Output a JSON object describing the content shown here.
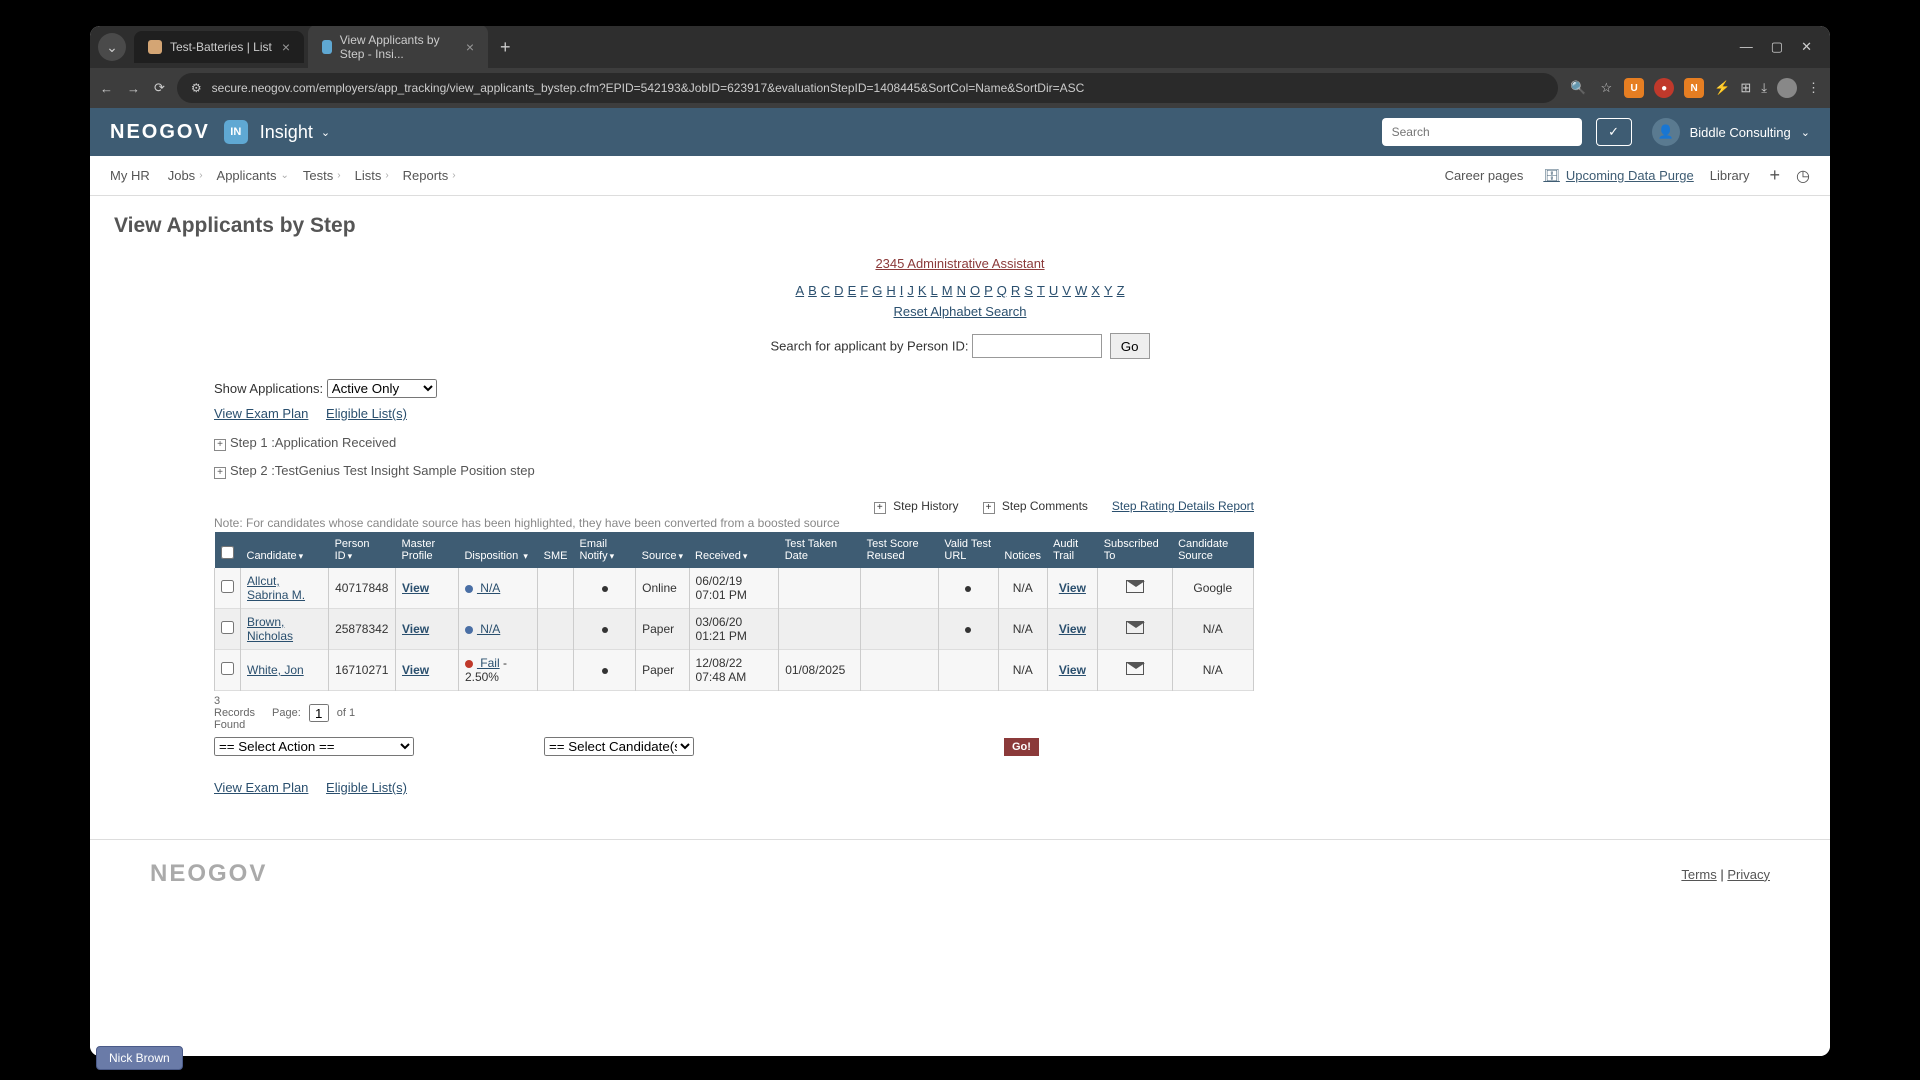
{
  "browser": {
    "tabs": [
      {
        "title": "Test-Batteries | List",
        "active": false,
        "favicon": "#d4a574"
      },
      {
        "title": "View Applicants by Step - Insi...",
        "active": true,
        "favicon": "#5fa8d3"
      }
    ],
    "url": "secure.neogov.com/employers/app_tracking/view_applicants_bystep.cfm?EPID=542193&JobID=623917&evaluationStepID=1408445&SortCol=Name&SortDir=ASC"
  },
  "header": {
    "logo": "NEOGOV",
    "badge": "IN",
    "product": "Insight",
    "search_placeholder": "Search",
    "user": "Biddle Consulting"
  },
  "nav": {
    "items": [
      "My HR",
      "Jobs",
      "Applicants",
      "Tests",
      "Lists",
      "Reports"
    ],
    "right": {
      "career": "Career pages",
      "purge": "Upcoming Data Purge",
      "library": "Library"
    }
  },
  "page": {
    "title": "View Applicants by Step",
    "job_link": "2345 Administrative Assistant",
    "alphabet": [
      "A",
      "B",
      "C",
      "D",
      "E",
      "F",
      "G",
      "H",
      "I",
      "J",
      "K",
      "L",
      "M",
      "N",
      "O",
      "P",
      "Q",
      "R",
      "S",
      "T",
      "U",
      "V",
      "W",
      "X",
      "Y",
      "Z"
    ],
    "reset_alpha": "Reset Alphabet Search",
    "search_label": "Search for applicant by Person ID:",
    "go_btn": "Go",
    "show_apps_label": "Show Applications:",
    "show_apps_value": "Active Only",
    "view_exam": "View Exam Plan",
    "eligible": "Eligible List(s)",
    "step1": "Step 1 :Application Received",
    "step2": "Step 2 :TestGenius Test Insight Sample Position step",
    "step_history": "Step History",
    "step_comments": "Step Comments",
    "step_rating": "Step Rating Details Report",
    "note": "Note: For candidates whose candidate source has been highlighted, they have been converted from a boosted source"
  },
  "table": {
    "headers": {
      "candidate": "Candidate",
      "person_id": "Person ID",
      "master": "Master Profile",
      "disposition": "Disposition",
      "sme": "SME",
      "email_notify": "Email Notify",
      "source": "Source",
      "received": "Received",
      "test_taken": "Test Taken Date",
      "test_score": "Test Score Reused",
      "valid_url": "Valid Test URL",
      "notices": "Notices",
      "audit": "Audit Trail",
      "subscribed": "Subscribed To",
      "cand_source": "Candidate Source"
    },
    "rows": [
      {
        "name": "Allcut, Sabrina M.",
        "person_id": "40717848",
        "master": "View",
        "disp_dot": "blue",
        "disp": " N/A",
        "source": "Online",
        "received": "06/02/19 07:01 PM",
        "test_taken": "",
        "notice": "N/A",
        "audit": "View",
        "cand_source": "Google"
      },
      {
        "name": "Brown, Nicholas ",
        "person_id": "25878342",
        "master": "View",
        "disp_dot": "blue",
        "disp": " N/A",
        "source": "Paper",
        "received": "03/06/20 01:21 PM",
        "test_taken": "",
        "notice": "N/A",
        "audit": "View",
        "cand_source": "N/A"
      },
      {
        "name": "White, Jon ",
        "person_id": "16710271",
        "master": "View",
        "disp_dot": "red",
        "disp": " Fail",
        "disp_extra": " - 2.50%",
        "source": "Paper",
        "received": "12/08/22 07:48 AM",
        "test_taken": "01/08/2025",
        "notice": "N/A",
        "audit": "View",
        "cand_source": "N/A"
      }
    ]
  },
  "pager": {
    "records": "3 Records Found",
    "page_label": "Page:",
    "page_val": "1",
    "of": "of 1"
  },
  "actions": {
    "select_action": "== Select Action ==",
    "select_cand": "== Select Candidate(s) ==",
    "go": "Go!"
  },
  "footer": {
    "logo": "NEOGOV",
    "terms": "Terms",
    "privacy": "Privacy"
  },
  "badge_name": "Nick Brown"
}
